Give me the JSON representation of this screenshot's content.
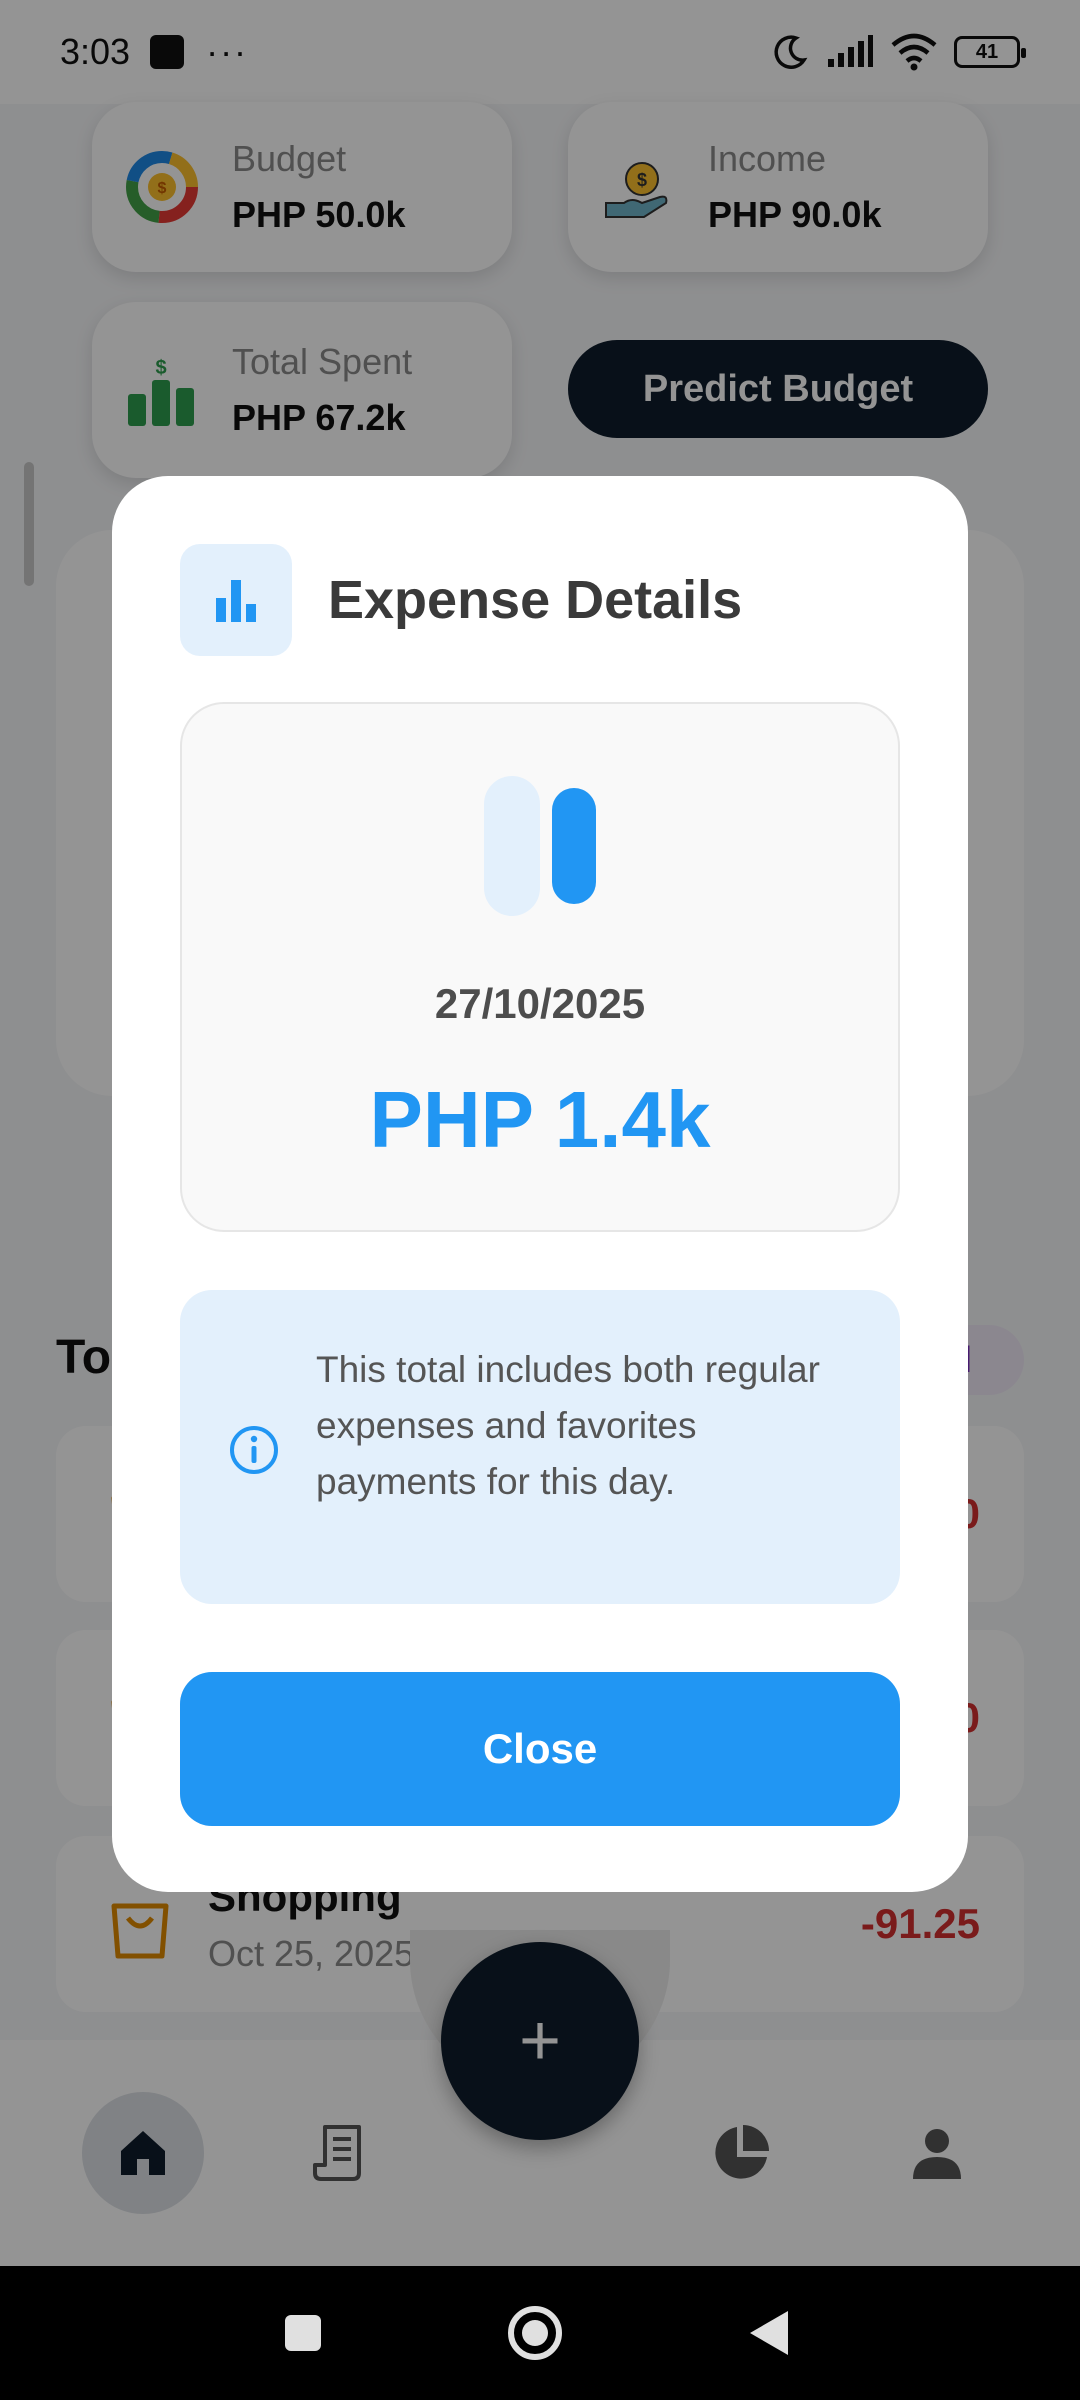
{
  "status_bar": {
    "time": "3:03",
    "dots": "···",
    "battery": "41"
  },
  "summary_cards": {
    "budget": {
      "label": "Budget",
      "value": "PHP 50.0k"
    },
    "income": {
      "label": "Income",
      "value": "PHP 90.0k"
    },
    "spent": {
      "label": "Total Spent",
      "value": "PHP 67.2k"
    }
  },
  "predict_button": "Predict Budget",
  "transactions_section": {
    "title_fragment": "To",
    "view_all_fragment": "ll"
  },
  "transactions": [
    {
      "name": "",
      "date": "",
      "amount": "0"
    },
    {
      "name": "",
      "date": "",
      "amount": "0"
    },
    {
      "name": "Shopping",
      "date": "Oct 25, 2025",
      "amount": "-91.25"
    }
  ],
  "fab_symbol": "+",
  "dialog": {
    "title": "Expense Details",
    "date": "27/10/2025",
    "amount": "PHP 1.4k",
    "info": "This total includes both regular expenses and favorites payments for this day.",
    "close_label": "Close"
  },
  "colors": {
    "accent_blue": "#2196f3",
    "light_blue": "#e3f0fc",
    "dark_navy": "#0f1d2b",
    "negative_red": "#d32f2f",
    "purple": "#7b2fbf"
  },
  "icons": {
    "dialog": "bar-chart-icon",
    "info": "info-circle-icon",
    "nav": [
      "home-icon",
      "receipt-icon",
      "pie-chart-icon",
      "person-icon"
    ]
  }
}
